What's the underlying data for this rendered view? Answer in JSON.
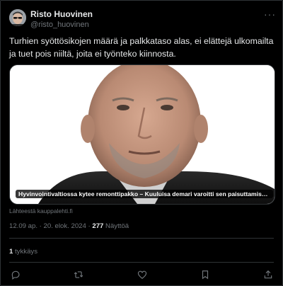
{
  "author": {
    "display_name": "Risto Huovinen",
    "handle": "@risto_huovinen"
  },
  "tweet": {
    "text": "Turhien syöttösikojen määrä ja palkkataso alas, ei elättejä ulkomailta ja tuet pois niiltä, joita ei työnteko kiinnosta."
  },
  "link_card": {
    "title": "Hyvinvointivaltiossa kytee remonttipakko – Kuuluisa demari varoitti sen paisuttamisesta…",
    "source": "Lähteestä kauppalehti.fi"
  },
  "meta": {
    "time": "12.09 ap.",
    "separator": " · ",
    "date": "20. elok. 2024",
    "views_count": "277",
    "views_label": "Näyttöä"
  },
  "engagement": {
    "likes_count": "1",
    "likes_label": "tykkäys"
  },
  "icons": {
    "more": "more-icon",
    "reply": "reply-icon",
    "retweet": "retweet-icon",
    "like": "like-icon",
    "bookmark": "bookmark-icon",
    "share": "share-icon"
  },
  "colors": {
    "background": "#000000",
    "text": "#e7e9ea",
    "secondary": "#71767b",
    "border": "#2f3336"
  }
}
